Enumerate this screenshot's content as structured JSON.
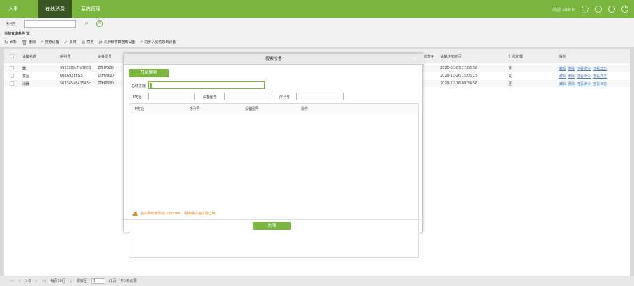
{
  "nav": {
    "items": [
      "入事",
      "在线消费",
      "系统管理"
    ],
    "welcome": "欢迎 admin"
  },
  "search": {
    "label": "序列号",
    "value": ""
  },
  "condition": "当前查询条件 无",
  "toolbar": [
    "刷新",
    "删除",
    "搜索设备",
    "启用",
    "禁用",
    "同步软件数据到设备",
    "同步人员信息到设备"
  ],
  "table": {
    "headers": [
      "设备名称",
      "序列号",
      "设备型号",
      "储盒子",
      "设备注册时间",
      "分机定理",
      "操作"
    ],
    "rows": [
      {
        "name": "器",
        "serial": "99172f0c7fd7803",
        "model": "ZTHP500",
        "reg_time": "2020-01-03 17:08:56",
        "flag": "否"
      },
      {
        "name": "意固",
        "serial": "608A92EEGS",
        "model": "ZTHP800",
        "reg_time": "2019-12-26 15:05:23",
        "flag": "是"
      },
      {
        "name": "消器",
        "serial": "503345a841543c",
        "model": "ZTHP500",
        "reg_time": "2019-12-16 09:34:56",
        "flag": "否"
      }
    ],
    "row_actions": [
      "编辑",
      "删除",
      "查看命令",
      "查看日志"
    ]
  },
  "pager": {
    "range": "1-3",
    "per_page": "每页50行",
    "goto_label": "跳转至",
    "goto_value": "1",
    "page_suffix": "/1页",
    "total": "共3条记录"
  },
  "dialog": {
    "title": "搜索设备",
    "start_button": "开始搜索",
    "progress_label": "总体进度",
    "progress": 0.02,
    "ip_label": "IP地址",
    "model_label": "设备型号",
    "serial_label": "序列号",
    "result_headers": [
      "IP地址",
      "序列号",
      "设备型号",
      "操作"
    ],
    "warning": "当前系统通讯端口为8088，请确保设备设置正确。",
    "close_button": "关闭"
  },
  "colors": {
    "brand": "#7ab540",
    "nav_active": "#3a5524",
    "warning": "#e08a2a"
  }
}
